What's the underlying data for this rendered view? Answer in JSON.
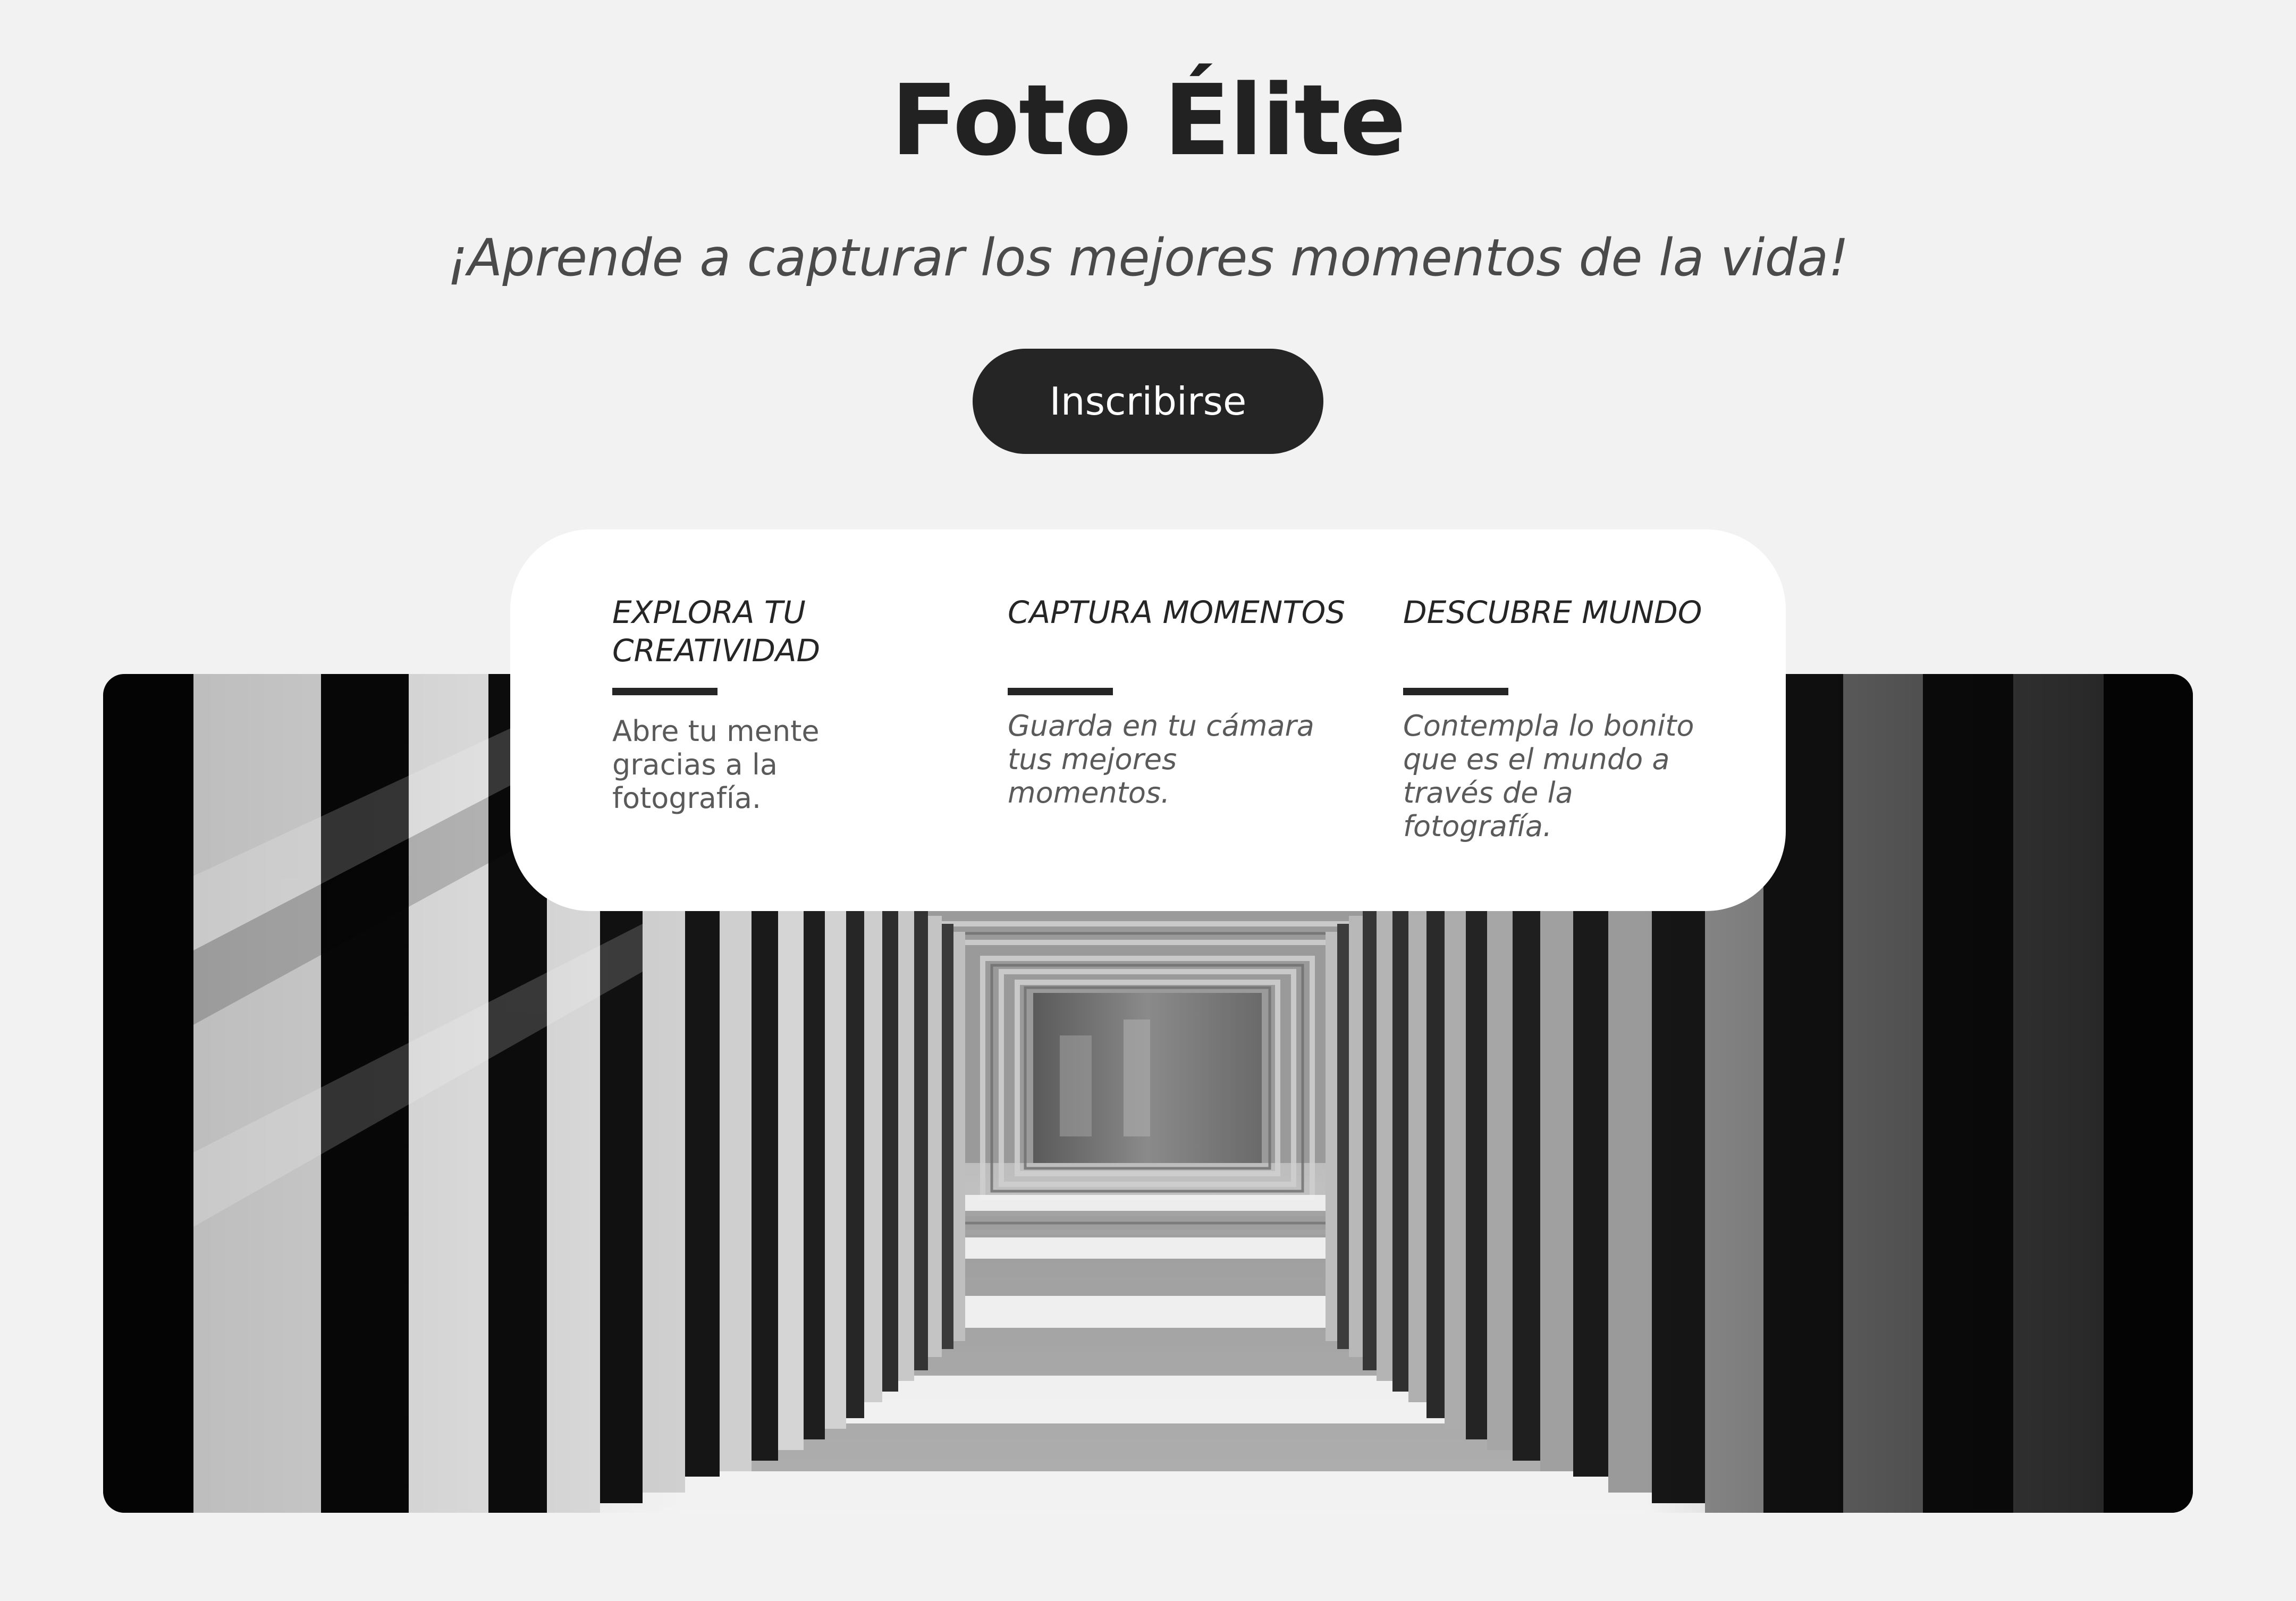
{
  "header": {
    "title": "Foto Élite",
    "subtitle": "¡Aprende a capturar los mejores momentos de la vida!",
    "cta_label": "Inscribirse"
  },
  "hero": {
    "image": "black-and-white-corridor-photo"
  },
  "features": [
    {
      "title": "EXPLORA TU CREATIVIDAD",
      "text": "Abre tu mente gracias a la fotografía."
    },
    {
      "title": "CAPTURA MOMENTOS",
      "text": "Guarda en tu cámara tus mejores momentos."
    },
    {
      "title": "DESCUBRE MUNDO",
      "text": "Contempla lo bonito que es el mundo a través de la fotografía."
    }
  ],
  "colors": {
    "background": "#f2f2f2",
    "primary": "#252525",
    "card": "#ffffff",
    "muted_text": "#5a5a5a"
  }
}
